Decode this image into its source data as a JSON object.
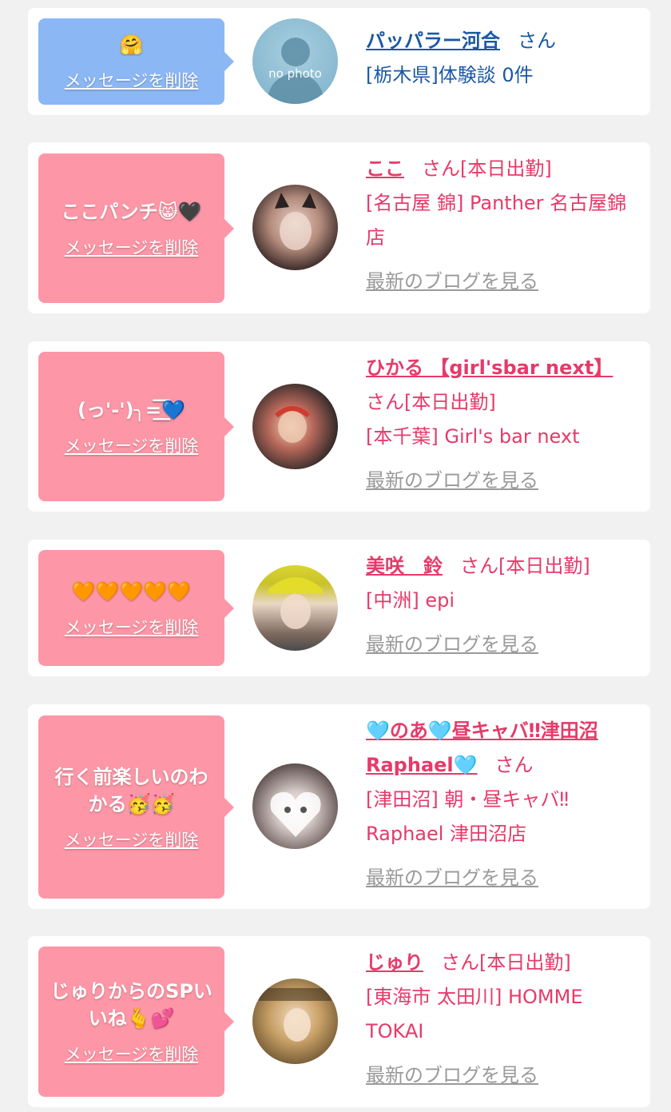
{
  "colors": {
    "page_bg": "#f1f1f1",
    "bubble_blue": "#8cb7f5",
    "bubble_pink": "#fd97a7",
    "name_pink": "#e63a6a",
    "name_blue": "#1a58a6",
    "blog_gray": "#9a9a9a"
  },
  "messages": [
    {
      "bubble_text": "🤗",
      "delete_label": "メッセージを削除",
      "avatar_label": "no photo",
      "name": "パッパラー河合",
      "san": "さん",
      "status": "",
      "location": "[栃木県]体験談 0件"
    },
    {
      "bubble_text": "ここパンチ😸🖤",
      "delete_label": "メッセージを削除",
      "name": "ここ",
      "san": "さん",
      "status": "[本日出勤]",
      "location": "[名古屋 錦] Panther 名古屋錦店",
      "blog_label": "最新のブログを見る"
    },
    {
      "bubble_text": "(っ'-')╮=͟͟͞͞💙",
      "delete_label": "メッセージを削除",
      "name": "ひかる 【girl'sbar next】",
      "san": "さん",
      "status": "[本日出勤]",
      "location": "[本千葉] Girl's bar next",
      "blog_label": "最新のブログを見る"
    },
    {
      "bubble_text": "🧡🧡🧡🧡🧡",
      "delete_label": "メッセージを削除",
      "name": "美咲　鈴",
      "san": "さん",
      "status": "[本日出勤]",
      "location": "[中洲] epi",
      "blog_label": "最新のブログを見る"
    },
    {
      "bubble_text": "行く前楽しいのわかる🥳🥳",
      "delete_label": "メッセージを削除",
      "name": "🩵のあ🩵昼キャバ‼津田沼Raphael🩵",
      "san": "さん",
      "status": "",
      "location": "[津田沼] 朝・昼キャバ‼Raphael 津田沼店",
      "blog_label": "最新のブログを見る"
    },
    {
      "bubble_text": "じゅりからのSPいいね🫰💕",
      "delete_label": "メッセージを削除",
      "name": "じゅり",
      "san": "さん",
      "status": "[本日出勤]",
      "location": "[東海市 太田川] HOMME TOKAI",
      "blog_label": "最新のブログを見る"
    }
  ]
}
